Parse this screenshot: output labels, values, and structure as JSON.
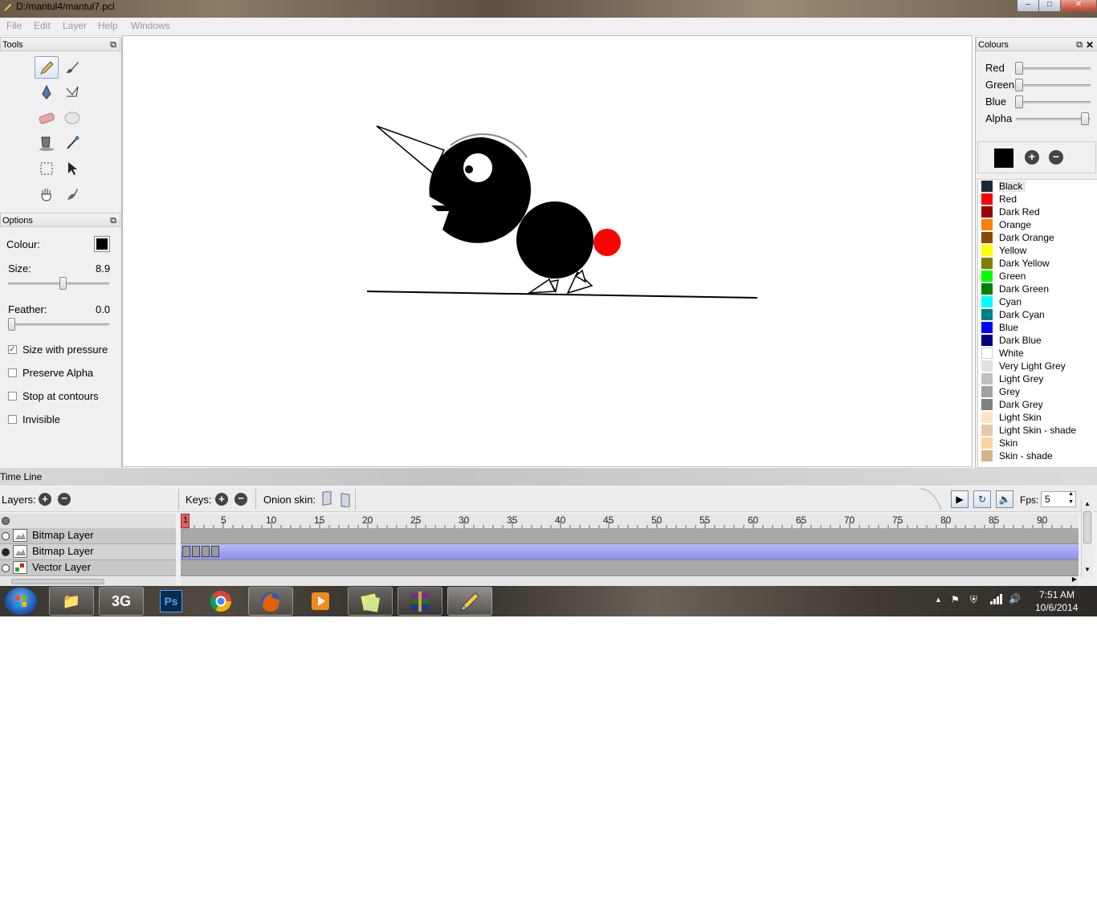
{
  "window": {
    "title": "D:/mantul4/mantul7.pcl"
  },
  "menu": [
    "File",
    "Edit",
    "Layer",
    "Help",
    "Windows"
  ],
  "tools_panel": {
    "title": "Tools"
  },
  "options_panel": {
    "title": "Options",
    "colour_label": "Colour:",
    "colour_value": "#000000",
    "size_label": "Size:",
    "size_value": "8.9",
    "feather_label": "Feather:",
    "feather_value": "0.0",
    "checkboxes": [
      {
        "label": "Size with pressure",
        "checked": true
      },
      {
        "label": "Preserve Alpha",
        "checked": false
      },
      {
        "label": "Stop at contours",
        "checked": false
      },
      {
        "label": "Invisible",
        "checked": false
      }
    ]
  },
  "colours_panel": {
    "title": "Colours",
    "sliders": [
      {
        "label": "Red",
        "value": 0
      },
      {
        "label": "Green",
        "value": 0
      },
      {
        "label": "Blue",
        "value": 0
      },
      {
        "label": "Alpha",
        "value": 1
      }
    ],
    "current_colour": "#000000",
    "swatches": [
      {
        "name": "Black",
        "color": "#1a2a3a"
      },
      {
        "name": "Red",
        "color": "#ff0000"
      },
      {
        "name": "Dark Red",
        "color": "#990000"
      },
      {
        "name": "Orange",
        "color": "#ff8000"
      },
      {
        "name": "Dark Orange",
        "color": "#8a4a00"
      },
      {
        "name": "Yellow",
        "color": "#ffff00"
      },
      {
        "name": "Dark Yellow",
        "color": "#808000"
      },
      {
        "name": "Green",
        "color": "#00ff00"
      },
      {
        "name": "Dark Green",
        "color": "#008000"
      },
      {
        "name": "Cyan",
        "color": "#00ffff"
      },
      {
        "name": "Dark Cyan",
        "color": "#008080"
      },
      {
        "name": "Blue",
        "color": "#0000ff"
      },
      {
        "name": "Dark Blue",
        "color": "#000080"
      },
      {
        "name": "White",
        "color": "#ffffff"
      },
      {
        "name": "Very Light Grey",
        "color": "#e0e0e0"
      },
      {
        "name": "Light Grey",
        "color": "#c0c0c0"
      },
      {
        "name": "Grey",
        "color": "#a0a0a0"
      },
      {
        "name": "Dark Grey",
        "color": "#808080"
      },
      {
        "name": "Light Skin",
        "color": "#ffe4c4"
      },
      {
        "name": "Light Skin - shade",
        "color": "#e6c8a8"
      },
      {
        "name": "Skin",
        "color": "#ffd39b"
      },
      {
        "name": "Skin - shade",
        "color": "#d2b48c"
      }
    ]
  },
  "timeline": {
    "title": "Time Line",
    "layers_label": "Layers:",
    "keys_label": "Keys:",
    "onion_label": "Onion skin:",
    "fps_label": "Fps:",
    "fps_value": "5",
    "current_frame": "1",
    "ruler": [
      "5",
      "10",
      "15",
      "20",
      "25",
      "30",
      "35",
      "40",
      "45",
      "50",
      "55",
      "60",
      "65",
      "70",
      "75",
      "80",
      "85",
      "90"
    ],
    "layers": [
      {
        "name": "Bitmap Layer",
        "active": false
      },
      {
        "name": "Bitmap Layer",
        "active": true
      },
      {
        "name": "Vector Layer",
        "active": false
      }
    ]
  },
  "taskbar": {
    "time": "7:51 AM",
    "date": "10/6/2014",
    "apps": [
      "explorer",
      "3G",
      "Ps",
      "chrome",
      "firefox",
      "media",
      "notes",
      "winrar",
      "pencil"
    ]
  }
}
